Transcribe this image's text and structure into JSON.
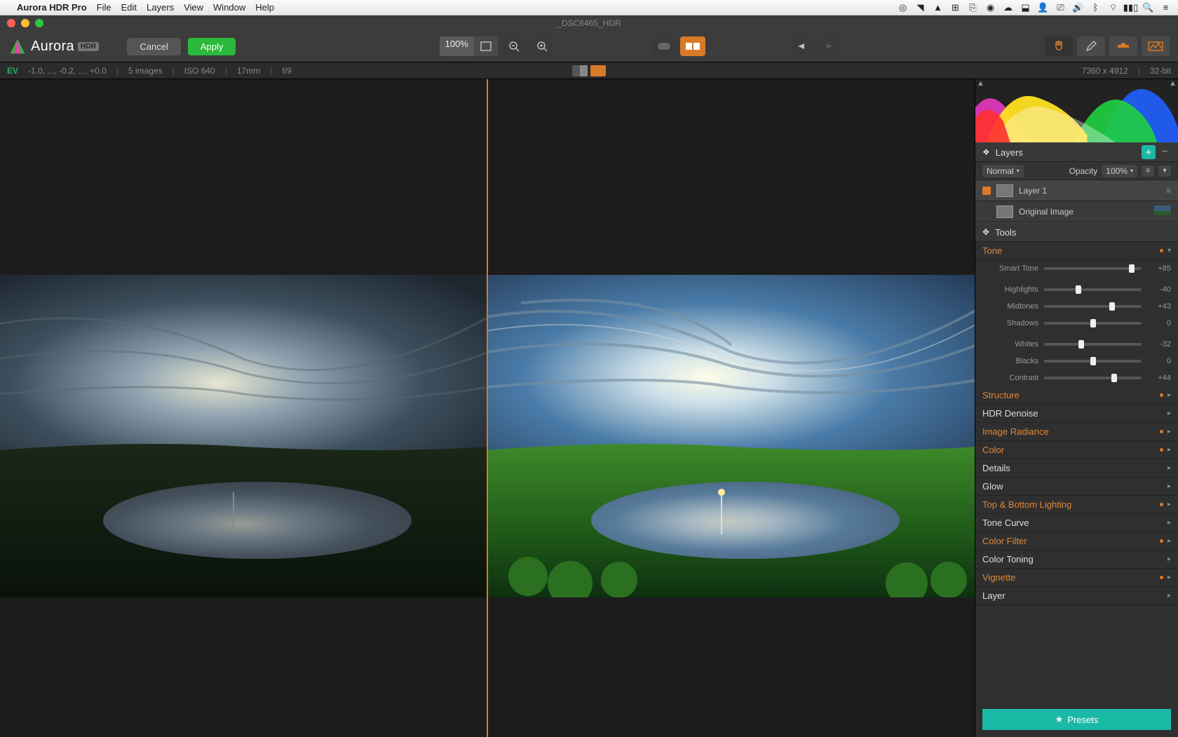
{
  "menubar": {
    "app": "Aurora HDR Pro",
    "items": [
      "File",
      "Edit",
      "Layers",
      "View",
      "Window",
      "Help"
    ]
  },
  "window": {
    "title": "_DSC6465_HDR"
  },
  "toolbar": {
    "logo_text": "Aurora",
    "logo_badge": "HDR",
    "cancel": "Cancel",
    "apply": "Apply",
    "zoom": "100%"
  },
  "infobar": {
    "ev_label": "EV",
    "ev_values": "-1.0, ..., -0.2, ..., +0.0",
    "count": "5 images",
    "iso": "ISO 640",
    "lens": "17mm",
    "aperture": "f/9",
    "dimensions": "7360 x 4912",
    "bitdepth": "32-bit"
  },
  "layers": {
    "header": "Layers",
    "blend_mode": "Normal",
    "opacity_label": "Opacity",
    "opacity_value": "100%",
    "items": [
      {
        "name": "Layer 1",
        "selected": true
      },
      {
        "name": "Original Image",
        "selected": false
      }
    ]
  },
  "tools": {
    "header": "Tools",
    "tone": {
      "label": "Tone",
      "sliders": [
        {
          "name": "Smart Tone",
          "value": "+85",
          "pos": 90
        },
        {
          "name": "Highlights",
          "value": "-40",
          "pos": 35
        },
        {
          "name": "Midtones",
          "value": "+43",
          "pos": 70
        },
        {
          "name": "Shadows",
          "value": "0",
          "pos": 50
        },
        {
          "name": "Whites",
          "value": "-32",
          "pos": 38
        },
        {
          "name": "Blacks",
          "value": "0",
          "pos": 50
        },
        {
          "name": "Contrast",
          "value": "+44",
          "pos": 72
        }
      ]
    },
    "sections": [
      {
        "label": "Structure",
        "orange": true
      },
      {
        "label": "HDR Denoise",
        "orange": false
      },
      {
        "label": "Image Radiance",
        "orange": true
      },
      {
        "label": "Color",
        "orange": true
      },
      {
        "label": "Details",
        "orange": false
      },
      {
        "label": "Glow",
        "orange": false
      },
      {
        "label": "Top & Bottom Lighting",
        "orange": true
      },
      {
        "label": "Tone Curve",
        "orange": false
      },
      {
        "label": "Color Filter",
        "orange": true
      },
      {
        "label": "Color Toning",
        "orange": false
      },
      {
        "label": "Vignette",
        "orange": true
      },
      {
        "label": "Layer",
        "orange": false
      }
    ]
  },
  "presets": {
    "label": "Presets"
  }
}
